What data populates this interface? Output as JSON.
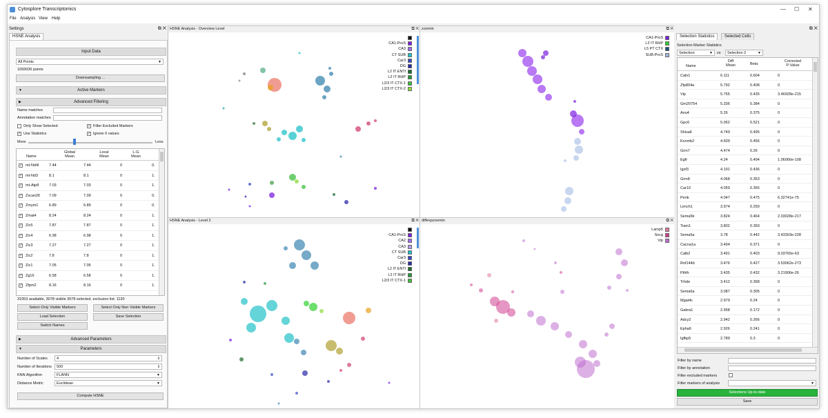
{
  "app": {
    "title": "Cytosplore Transcriptomics",
    "brand_color": "#4d8fd6"
  },
  "window_controls": {
    "minimize": "—",
    "maximize": "☐",
    "close": "✕"
  },
  "menu": [
    "File",
    "Analysis",
    "View",
    "Help"
  ],
  "settings": {
    "header": "Settings",
    "tab": "HSNE Analysis",
    "input_data": {
      "title": "Input Data",
      "dataset": "All Points",
      "points": "1093036 points",
      "downsampling": "Downsampling ..."
    },
    "active_markers": {
      "title": "Active Markers",
      "advanced_filtering": "Advanced Filtering",
      "name_matches": "Name matches",
      "annotation_matches": "Annotation matches",
      "only_show_selected": "Only Show Selected",
      "filter_excluded": "Filter Excluded Markers",
      "use_statistics": "Use Statistics",
      "ignore_zero": "Ignore 0 values",
      "more": "More",
      "less": "Less",
      "columns": [
        "Name",
        "Global\nMean",
        "Local\nMean",
        "L-G\nMean"
      ],
      "rows": [
        [
          "mt-Nd4l",
          "7.44",
          "7.44",
          "0",
          "0."
        ],
        [
          "mt-Nd3",
          "8.1",
          "8.1",
          "0",
          "1."
        ],
        [
          "mt-Atp8",
          "7.03",
          "7.03",
          "0",
          "1."
        ],
        [
          "Zscan26",
          "7.09",
          "7.09",
          "0",
          "0."
        ],
        [
          "Zmym1",
          "6.89",
          "6.89",
          "0",
          "0."
        ],
        [
          "Zmat4",
          "8.24",
          "8.24",
          "0",
          "1."
        ],
        [
          "Zic5",
          "7.87",
          "7.87",
          "0",
          "1."
        ],
        [
          "Zic4",
          "6.98",
          "6.98",
          "0",
          "1."
        ],
        [
          "Zic3",
          "7.27",
          "7.27",
          "0",
          "1."
        ],
        [
          "Zic2",
          "7.8",
          "7.8",
          "0",
          "1."
        ],
        [
          "Zic1",
          "7.05",
          "7.05",
          "0",
          "1."
        ],
        [
          "Zg16",
          "6.58",
          "6.58",
          "0",
          "1."
        ],
        [
          "Zfpm2",
          "8.16",
          "8.16",
          "0",
          "1."
        ]
      ],
      "status": "31053 available, 3078 visible 3078 selected. exclusion list: 1130",
      "select_visible": "Select Only Visible Markers",
      "select_non_visible": "Select Only Non Visible Markers",
      "load_selection": "Load Selection",
      "save_selection": "Save Selection",
      "switch_names": "Switch Names"
    },
    "advanced_parameters": "Advanced Parameters",
    "parameters": {
      "title": "Parameters",
      "scales_label": "Number of Scales",
      "scales_value": "4",
      "iterations_label": "Number of Iterations",
      "iterations_value": "500",
      "knn_label": "KNN Algorithm",
      "knn_value": "FLANN",
      "distance_label": "Distance Metric",
      "distance_value": "Euclidean"
    },
    "compute": "Compute HSNE"
  },
  "views": {
    "overview": {
      "title": "HSNE Analysis - Overview Level",
      "legend": [
        {
          "label": "",
          "color": "#111111"
        },
        {
          "label": "CA1-ProS",
          "color": "#7a1fe0"
        },
        {
          "label": "CA3",
          "color": "#9f6df0"
        },
        {
          "label": "CT SUB",
          "color": "#22c2c8"
        },
        {
          "label": "Car3",
          "color": "#3a47c0"
        },
        {
          "label": "DG",
          "color": "#2a2aa8"
        },
        {
          "label": "L2 IT ENTl",
          "color": "#1f6b2e"
        },
        {
          "label": "L2 IT RHP",
          "color": "#2a9a3a"
        },
        {
          "label": "L2/3 IT CTX-1",
          "color": "#3fbf3f"
        },
        {
          "label": "L2/3 IT CTX-2",
          "color": "#8edc3a"
        }
      ]
    },
    "zoomin": {
      "title": "zoomin",
      "legend": [
        {
          "label": "CA1-ProS",
          "color": "#7a1fe0"
        },
        {
          "label": "L2 IT RHP",
          "color": "#2fd12f"
        },
        {
          "label": "L5 PT CTX",
          "color": "#1a4f7a"
        },
        {
          "label": "SUB-ProS",
          "color": "#a0b8e0"
        }
      ]
    },
    "level2": {
      "title": "HSNE Analysis - Level 2",
      "legend": [
        {
          "label": "",
          "color": "#111111"
        },
        {
          "label": "CA1-ProS",
          "color": "#7a1fe0"
        },
        {
          "label": "CA2",
          "color": "#9f6df0"
        },
        {
          "label": "CA3",
          "color": "#b79af5"
        },
        {
          "label": "CT SUB",
          "color": "#22c2c8"
        },
        {
          "label": "Car3",
          "color": "#3a47c0"
        },
        {
          "label": "DG",
          "color": "#2a2aa8"
        },
        {
          "label": "L2 IT ENTl",
          "color": "#1f6b2e"
        },
        {
          "label": "L2 IT RHP",
          "color": "#2a9a3a"
        },
        {
          "label": "L2/3 IT CTX-1",
          "color": "#3fbf3f"
        }
      ]
    },
    "diffexp": {
      "title": "diffexpzoomin",
      "legend": [
        {
          "label": "Lamp5",
          "color": "#e07aa0"
        },
        {
          "label": "Sncg",
          "color": "#d04090"
        },
        {
          "label": "Vip",
          "color": "#c070d0"
        }
      ]
    }
  },
  "stats": {
    "tabs": [
      "Selection Statistics",
      "Selected Cells"
    ],
    "section": "Selection Marker Statistics",
    "left_select": "Selection",
    "vs": "vs",
    "right_select": "Selection 2",
    "columns": [
      "Name",
      "Diff\nMean",
      "Beta",
      "Corrected\nP-Value"
    ],
    "rows": [
      [
        "Caln1",
        "6.111",
        "0.604",
        "0"
      ],
      [
        "Zfp804a",
        "5.792",
        "0.408",
        "0"
      ],
      [
        "Vip",
        "5.755",
        "0.435",
        "3.46928e-215"
      ],
      [
        "Gm20754",
        "5.336",
        "0.384",
        "0"
      ],
      [
        "Ano4",
        "5.26",
        "0.375",
        "0"
      ],
      [
        "Gpc6",
        "5.062",
        "0.521",
        "0"
      ],
      [
        "Shisa6",
        "4.749",
        "0.495",
        "0"
      ],
      [
        "Kcnmb2",
        "4.609",
        "0.456",
        "0"
      ],
      [
        "Grm7",
        "4.474",
        "0.26",
        "0"
      ],
      [
        "Egfr",
        "4.24",
        "0.494",
        "1.06066e-108"
      ],
      [
        "Igsf3",
        "4.191",
        "0.436",
        "0"
      ],
      [
        "Grm8",
        "4.068",
        "0.353",
        "0"
      ],
      [
        "Car10",
        "4.059",
        "0.355",
        "0"
      ],
      [
        "Penk",
        "4.047",
        "0.475",
        "6.32741e-75"
      ],
      [
        "Limch1",
        "3.974",
        "0.259",
        "0"
      ],
      [
        "Sema5b",
        "3.824",
        "0.464",
        "2.03028e-217"
      ],
      [
        "Tiam1",
        "3.802",
        "0.393",
        "0"
      ],
      [
        "Sema5a",
        "3.78",
        "0.442",
        "3.43303e-228"
      ],
      [
        "Cacna1a",
        "3.494",
        "0.371",
        "0"
      ],
      [
        "Calb2",
        "3.491",
        "0.403",
        "9.03765e-63"
      ],
      [
        "Rnf144b",
        "3.476",
        "0.427",
        "3.53062e-273"
      ],
      [
        "Pthlh",
        "3.435",
        "0.432",
        "3.21906e-26"
      ],
      [
        "Trhde",
        "3.412",
        "0.368",
        "0"
      ],
      [
        "Sema6a",
        "3.087",
        "0.305",
        "0"
      ],
      [
        "Mgat4c",
        "2.979",
        "0.24",
        "0"
      ],
      [
        "Gabra1",
        "2.958",
        "0.172",
        "0"
      ],
      [
        "Adcy2",
        "2.942",
        "0.266",
        "0"
      ],
      [
        "Epha6",
        "2.926",
        "0.241",
        "0"
      ],
      [
        "Igfbp5",
        "2.789",
        "0.3",
        "0"
      ]
    ],
    "filter_name": "Filter by name",
    "filter_annotation": "Filter by annotation",
    "filter_excluded": "Filter excluded markers",
    "filter_analysis": "Filter markers of analysis",
    "status_button": "Selections Up-to-date",
    "status_color": "#28b33c",
    "save": "Save"
  }
}
